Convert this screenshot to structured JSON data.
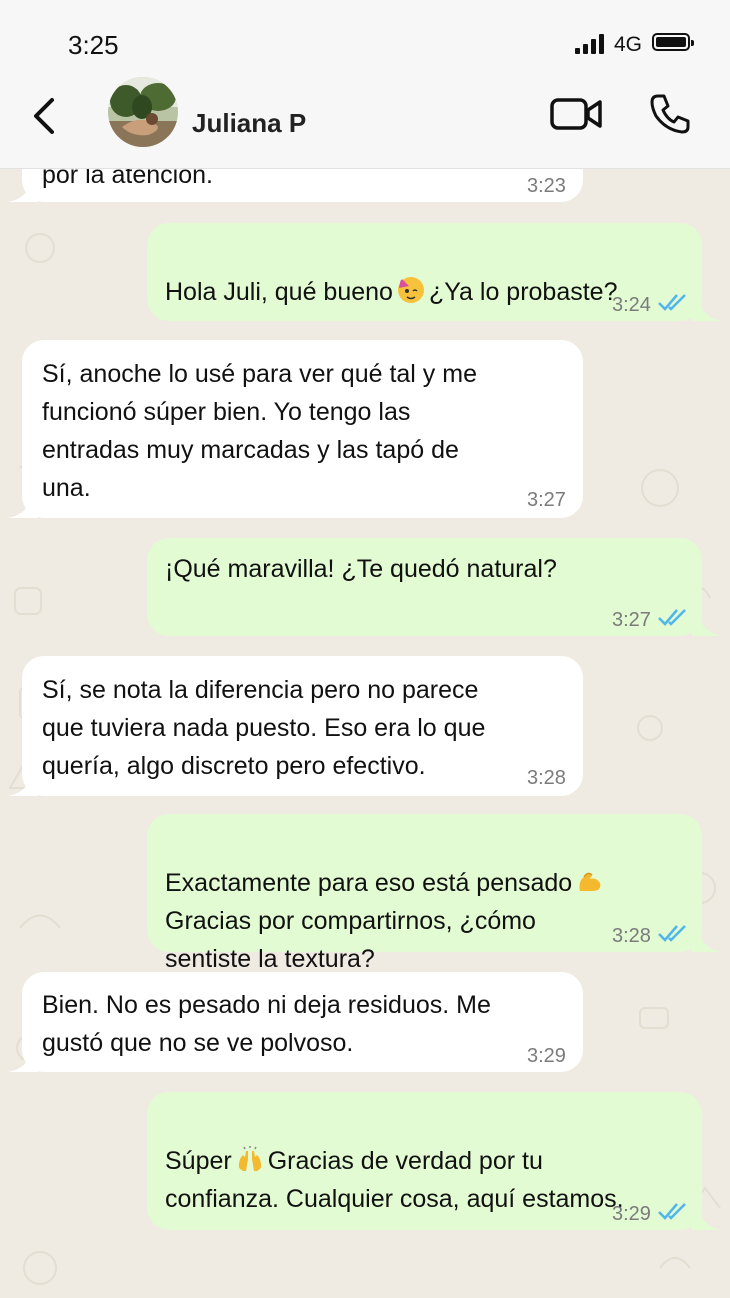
{
  "status_bar": {
    "time": "3:25",
    "network": "4G"
  },
  "header": {
    "contact_name": "Juliana P"
  },
  "messages": [
    {
      "direction": "in",
      "text": "por la atención.",
      "time": "3:23"
    },
    {
      "direction": "out",
      "text_before": "Hola Juli, qué bueno",
      "emoji": "party-face-emoji",
      "text_after": "¿Ya lo probaste?",
      "time": "3:24",
      "status": "read"
    },
    {
      "direction": "in",
      "text": "Sí, anoche lo usé para ver qué tal y me\nfuncionó súper bien. Yo tengo las\nentradas muy marcadas y las tapó de\nuna.",
      "time": "3:27"
    },
    {
      "direction": "out",
      "text": "¡Qué maravilla! ¿Te quedó natural?",
      "time": "3:27",
      "status": "read"
    },
    {
      "direction": "in",
      "text": "Sí, se nota la diferencia pero no parece\nque tuviera nada puesto. Eso era lo que\nquería, algo discreto pero efectivo.",
      "time": "3:28"
    },
    {
      "direction": "out",
      "text_before": "Exactamente para eso está pensado",
      "emoji": "flexed-biceps-emoji",
      "text_after": "Gracias por compartirnos, ¿cómo\nsentiste la textura?",
      "time": "3:28",
      "status": "read"
    },
    {
      "direction": "in",
      "text": "Bien. No es pesado ni deja residuos. Me\ngustó que no se ve polvoso.",
      "time": "3:29"
    },
    {
      "direction": "out",
      "text_before": "Súper",
      "emoji": "raising-hands-emoji",
      "text_after": "Gracias de verdad por tu\nconfianza. Cualquier cosa, aquí estamos.",
      "time": "3:29",
      "status": "read"
    }
  ],
  "colors": {
    "incoming_bubble": "#ffffff",
    "outgoing_bubble": "#e2fbd3",
    "read_ticks": "#4fb6ec",
    "chat_background": "#efeae2"
  }
}
